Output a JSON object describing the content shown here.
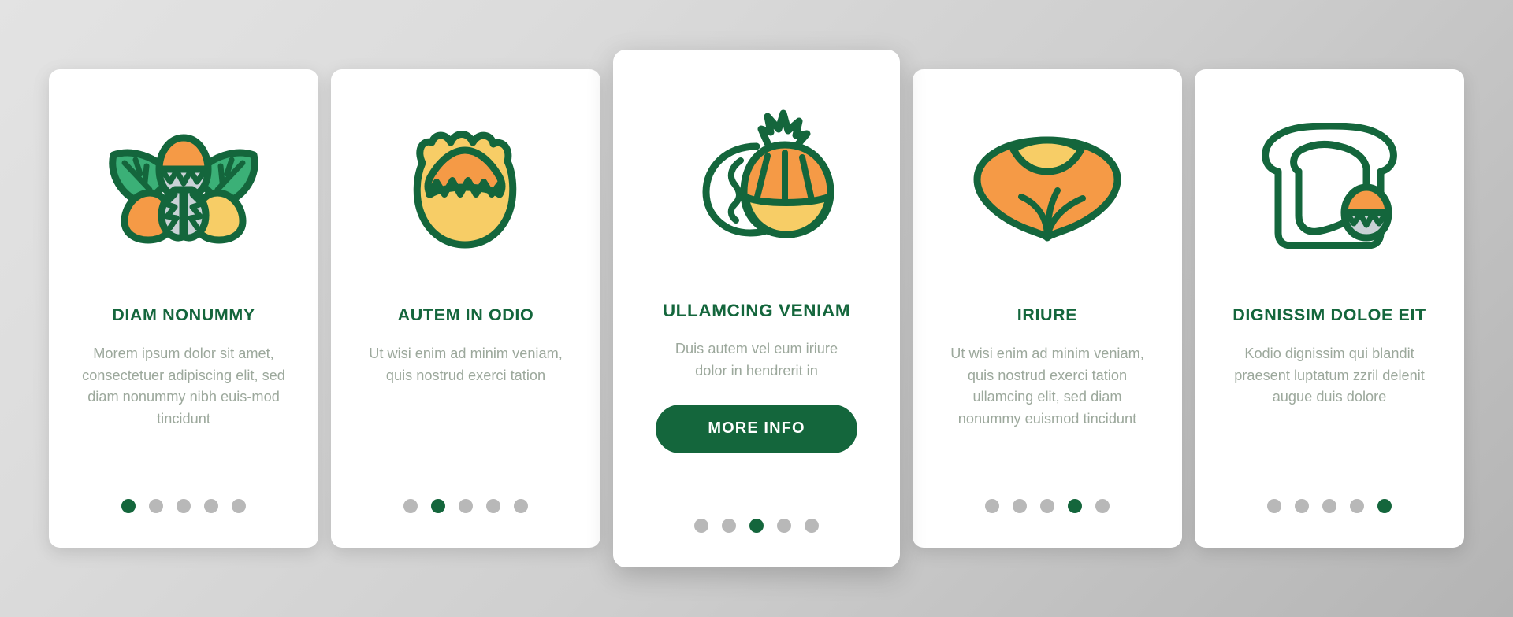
{
  "theme": {
    "brand_green": "#14663c",
    "leaf_green": "#3bb077",
    "orange": "#f59a46",
    "yellow": "#f7cd66",
    "gray_text": "#9ca89c",
    "dot_inactive": "#b8b8b8"
  },
  "cards": [
    {
      "icon": "acorns-with-leaves-icon",
      "title": "DIAM NONUMMY",
      "body": "Morem ipsum dolor sit amet, consectetuer adipiscing elit, sed diam nonummy nibh euis-mod tincidunt",
      "featured": false,
      "cta": null,
      "dots": {
        "count": 5,
        "active": 1
      }
    },
    {
      "icon": "chestnut-husk-icon",
      "title": "AUTEM IN ODIO",
      "body": "Ut wisi enim ad minim veniam, quis nostrud exerci tation",
      "featured": false,
      "cta": null,
      "dots": {
        "count": 5,
        "active": 2
      }
    },
    {
      "icon": "hazelnut-pair-icon",
      "title": "ULLAMCING VENIAM",
      "body": "Duis autem vel eum iriure dolor in hendrerit in",
      "featured": true,
      "cta": "MORE INFO",
      "dots": {
        "count": 5,
        "active": 3
      }
    },
    {
      "icon": "onion-bulb-icon",
      "title": "IRIURE",
      "body": "Ut wisi enim ad minim veniam, quis nostrud exerci tation ullamcing elit, sed diam nonummy euismod tincidunt",
      "featured": false,
      "cta": null,
      "dots": {
        "count": 5,
        "active": 4
      }
    },
    {
      "icon": "bread-slice-with-acorn-icon",
      "title": "DIGNISSIM DOLOE EIT",
      "body": "Kodio dignissim qui blandit praesent luptatum zzril delenit augue duis dolore",
      "featured": false,
      "cta": null,
      "dots": {
        "count": 5,
        "active": 5
      }
    }
  ]
}
